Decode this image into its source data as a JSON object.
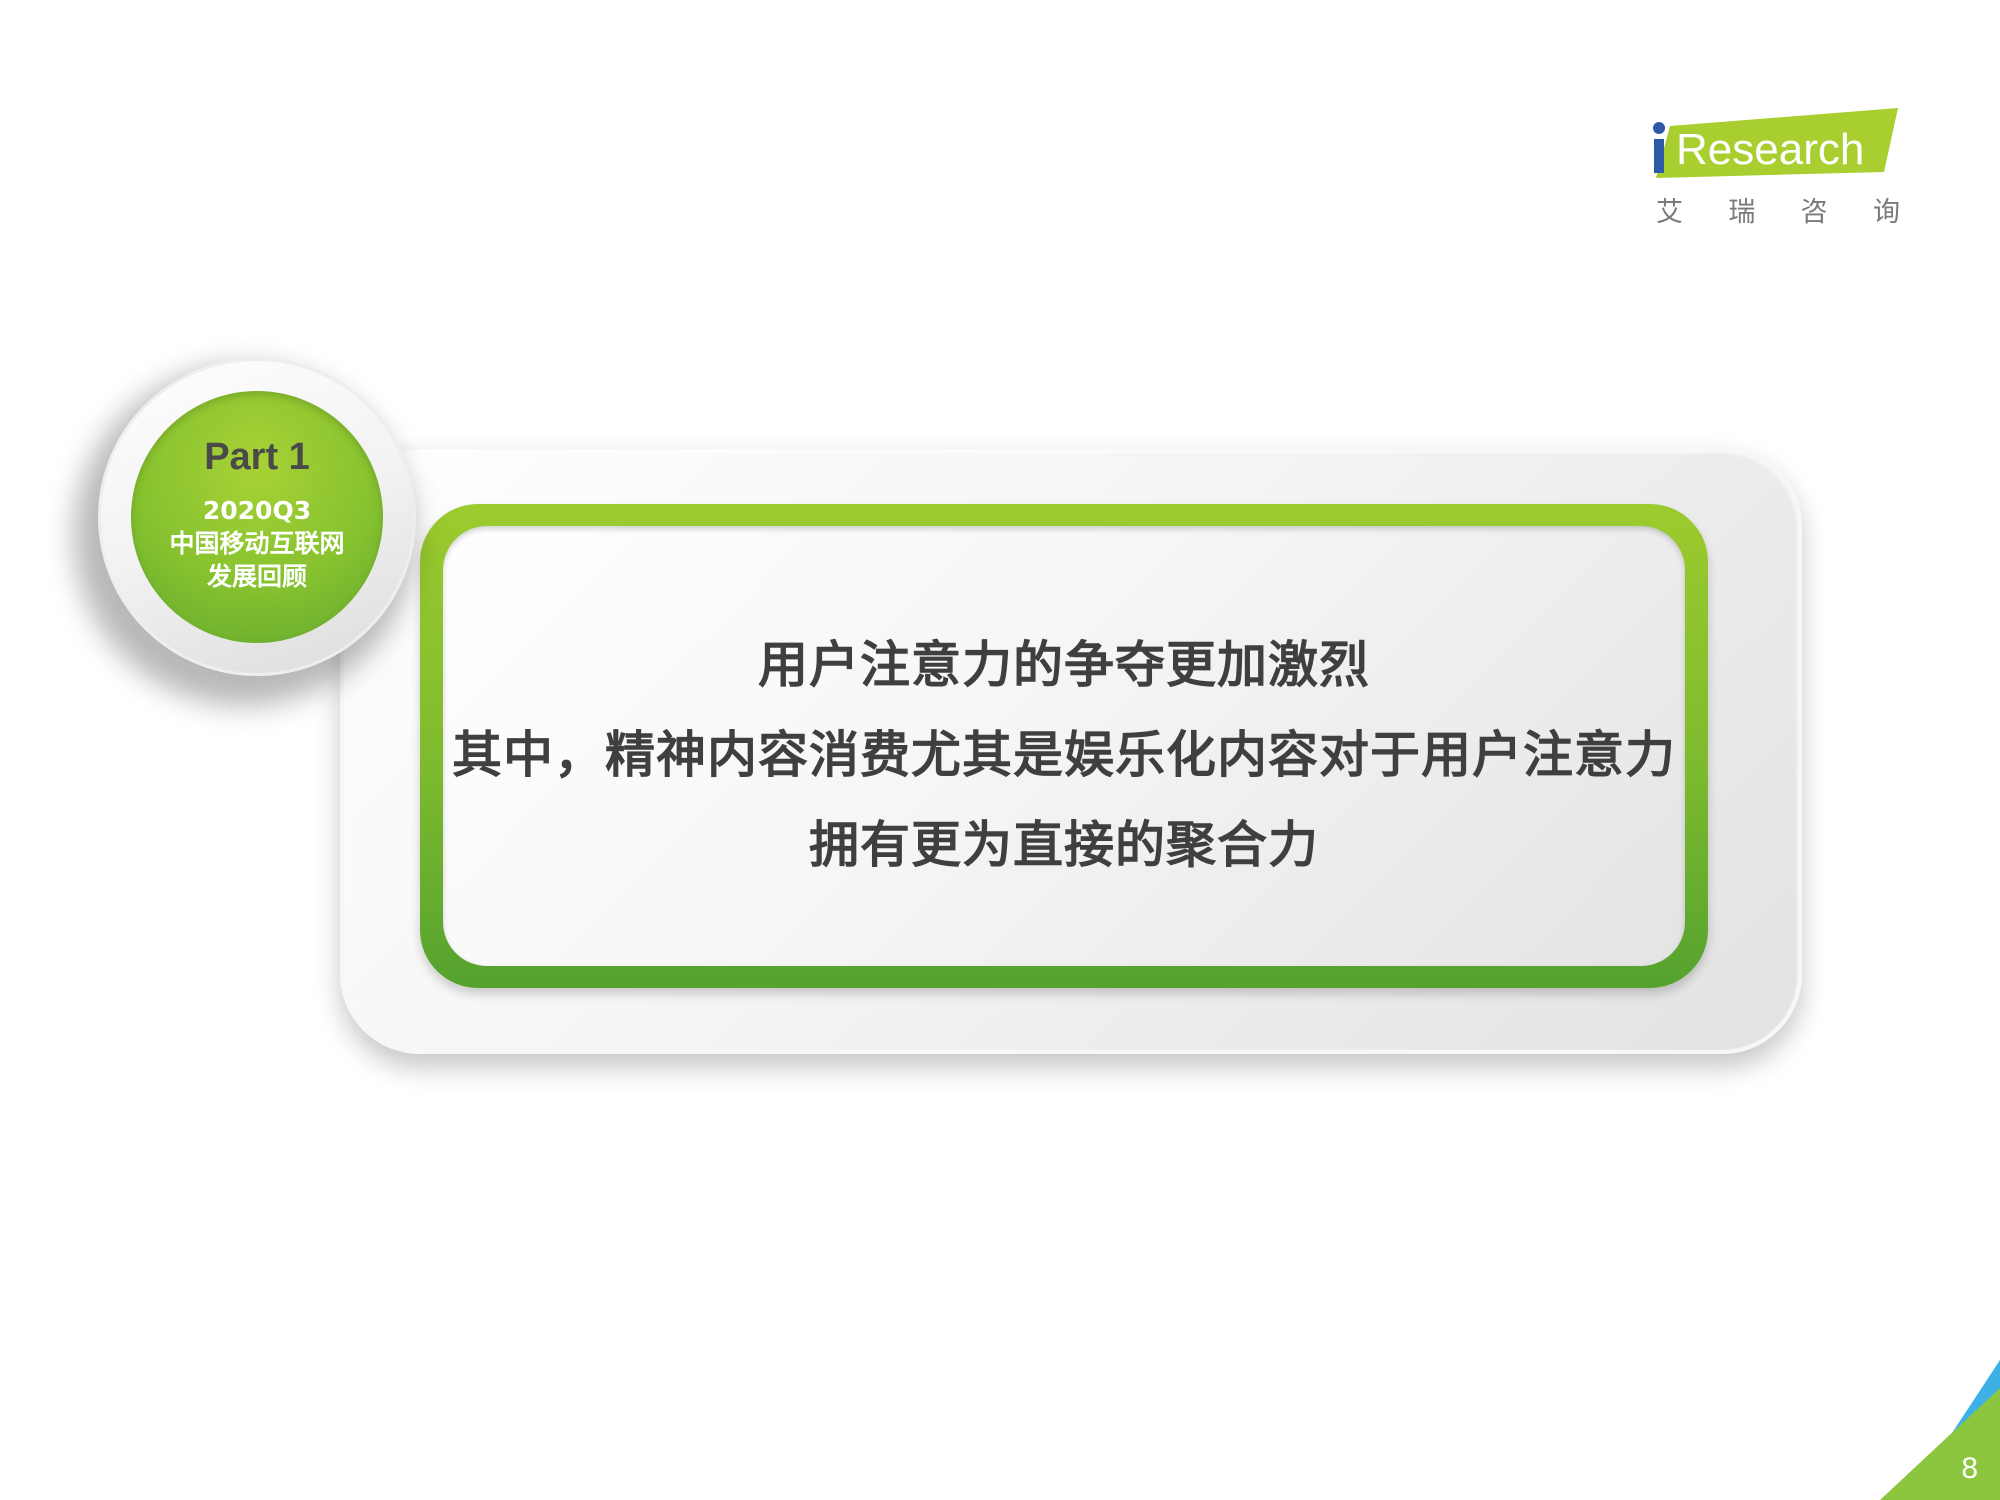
{
  "logo": {
    "brand": "iResearch",
    "chinese_chars": [
      "艾",
      "瑞",
      "咨",
      "询"
    ],
    "accent_color": "#a8cf2f",
    "dot_color": "#2d5aa6"
  },
  "badge": {
    "part": "Part 1",
    "lines": [
      "2020Q3",
      "中国移动互联网",
      "发展回顾"
    ],
    "color": "#86c22f"
  },
  "card": {
    "lines": [
      "用户注意力的争夺更加激烈",
      "其中，精神内容消费尤其是娱乐化内容对于用户注意力",
      "拥有更为直接的聚合力"
    ],
    "border_color": "#7dba2e",
    "text_color": "#3f3f3f"
  },
  "page": {
    "number": "8",
    "corner_colors": [
      "#3db0e6",
      "#8cc63f"
    ]
  }
}
